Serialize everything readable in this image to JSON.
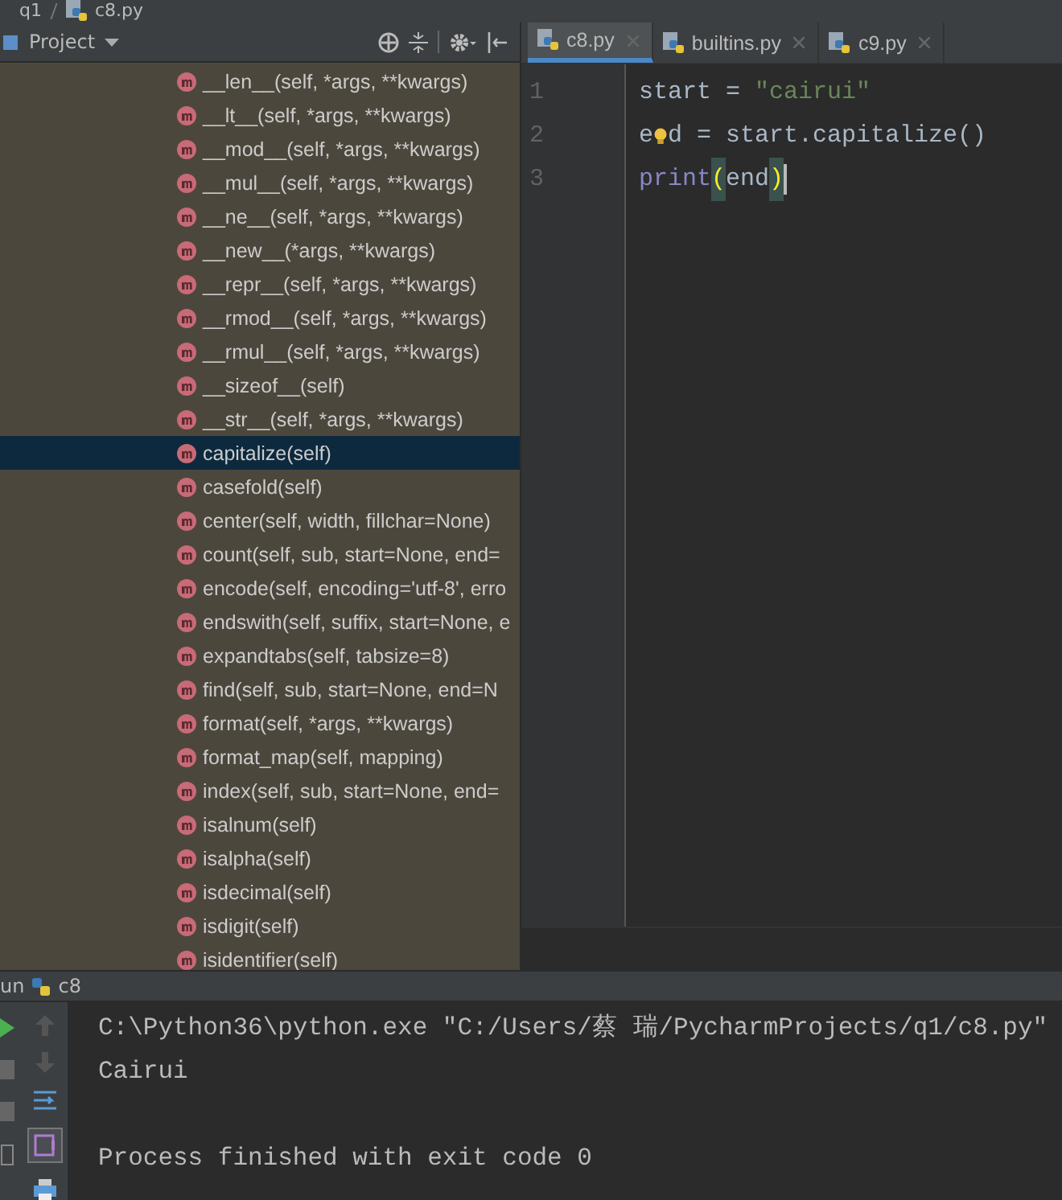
{
  "breadcrumb": [
    "q1",
    "c8.py"
  ],
  "project_panel": {
    "title": "Project",
    "items": [
      {
        "label": "__len__(self, *args, **kwargs)",
        "selected": false
      },
      {
        "label": "__lt__(self, *args, **kwargs)",
        "selected": false
      },
      {
        "label": "__mod__(self, *args, **kwargs)",
        "selected": false
      },
      {
        "label": "__mul__(self, *args, **kwargs)",
        "selected": false
      },
      {
        "label": "__ne__(self, *args, **kwargs)",
        "selected": false
      },
      {
        "label": "__new__(*args, **kwargs)",
        "selected": false
      },
      {
        "label": "__repr__(self, *args, **kwargs)",
        "selected": false
      },
      {
        "label": "__rmod__(self, *args, **kwargs)",
        "selected": false
      },
      {
        "label": "__rmul__(self, *args, **kwargs)",
        "selected": false
      },
      {
        "label": "__sizeof__(self)",
        "selected": false
      },
      {
        "label": "__str__(self, *args, **kwargs)",
        "selected": false
      },
      {
        "label": "capitalize(self)",
        "selected": true
      },
      {
        "label": "casefold(self)",
        "selected": false
      },
      {
        "label": "center(self, width, fillchar=None)",
        "selected": false
      },
      {
        "label": "count(self, sub, start=None, end=",
        "selected": false
      },
      {
        "label": "encode(self, encoding='utf-8', erro",
        "selected": false
      },
      {
        "label": "endswith(self, suffix, start=None, e",
        "selected": false
      },
      {
        "label": "expandtabs(self, tabsize=8)",
        "selected": false
      },
      {
        "label": "find(self, sub, start=None, end=N",
        "selected": false
      },
      {
        "label": "format(self, *args, **kwargs)",
        "selected": false
      },
      {
        "label": "format_map(self, mapping)",
        "selected": false
      },
      {
        "label": "index(self, sub, start=None, end=",
        "selected": false
      },
      {
        "label": "isalnum(self)",
        "selected": false
      },
      {
        "label": "isalpha(self)",
        "selected": false
      },
      {
        "label": "isdecimal(self)",
        "selected": false
      },
      {
        "label": "isdigit(self)",
        "selected": false
      },
      {
        "label": "isidentifier(self)",
        "selected": false
      }
    ]
  },
  "editor": {
    "tabs": [
      {
        "label": "c8.py",
        "selected": true
      },
      {
        "label": "builtins.py",
        "selected": false
      },
      {
        "label": "c9.py",
        "selected": false
      }
    ],
    "lines": [
      {
        "number": "1",
        "tokens": [
          {
            "kind": "plain",
            "text": "start = "
          },
          {
            "kind": "string",
            "text": "\"cairui\""
          }
        ]
      },
      {
        "number": "2",
        "tokens": [
          {
            "kind": "plain",
            "text": "e"
          },
          {
            "kind": "bulb"
          },
          {
            "kind": "plain",
            "text": "d = start.capitalize()"
          }
        ]
      },
      {
        "number": "3",
        "tokens": [
          {
            "kind": "builtin",
            "text": "print"
          },
          {
            "kind": "brace",
            "text": "("
          },
          {
            "kind": "plain",
            "text": "end"
          },
          {
            "kind": "brace",
            "text": ")"
          }
        ]
      }
    ]
  },
  "run_panel": {
    "title": "un",
    "config": "c8",
    "output": [
      {
        "kind": "text",
        "text": "C:\\Python36\\python.exe \"C:/Users/蔡 瑞/PycharmProjects/q1/c8.py\""
      },
      {
        "kind": "text",
        "text": "Cairui"
      },
      {
        "kind": "blank"
      },
      {
        "kind": "text",
        "text": "Process finished with exit code 0"
      }
    ]
  }
}
